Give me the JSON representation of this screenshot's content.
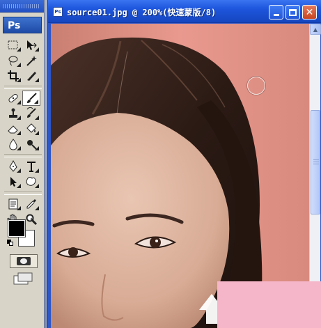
{
  "toolbox": {
    "logo": "Ps",
    "tools": [
      [
        "marquee-icon",
        "move-icon"
      ],
      [
        "lasso-icon",
        "magic-wand-icon"
      ],
      [
        "crop-icon",
        "slice-icon"
      ],
      [
        "healing-brush-icon",
        "brush-icon"
      ],
      [
        "clone-stamp-icon",
        "history-brush-icon"
      ],
      [
        "eraser-icon",
        "paint-bucket-icon"
      ],
      [
        "blur-icon",
        "dodge-icon"
      ],
      [
        "pen-icon",
        "type-icon"
      ],
      [
        "path-selection-icon",
        "shape-icon"
      ],
      [
        "notes-icon",
        "eyedropper-icon"
      ],
      [
        "hand-icon",
        "zoom-icon"
      ]
    ],
    "active_tool": "brush-icon",
    "foreground_color": "#000000",
    "background_color": "#ffffff"
  },
  "document": {
    "title": "source01.jpg @ 200%(快速蒙版/8)",
    "icon_label": "Ps"
  },
  "colors": {
    "titlebar": "#1d55dc",
    "close_button": "#c64520",
    "overlay": "#f6b6c9"
  }
}
